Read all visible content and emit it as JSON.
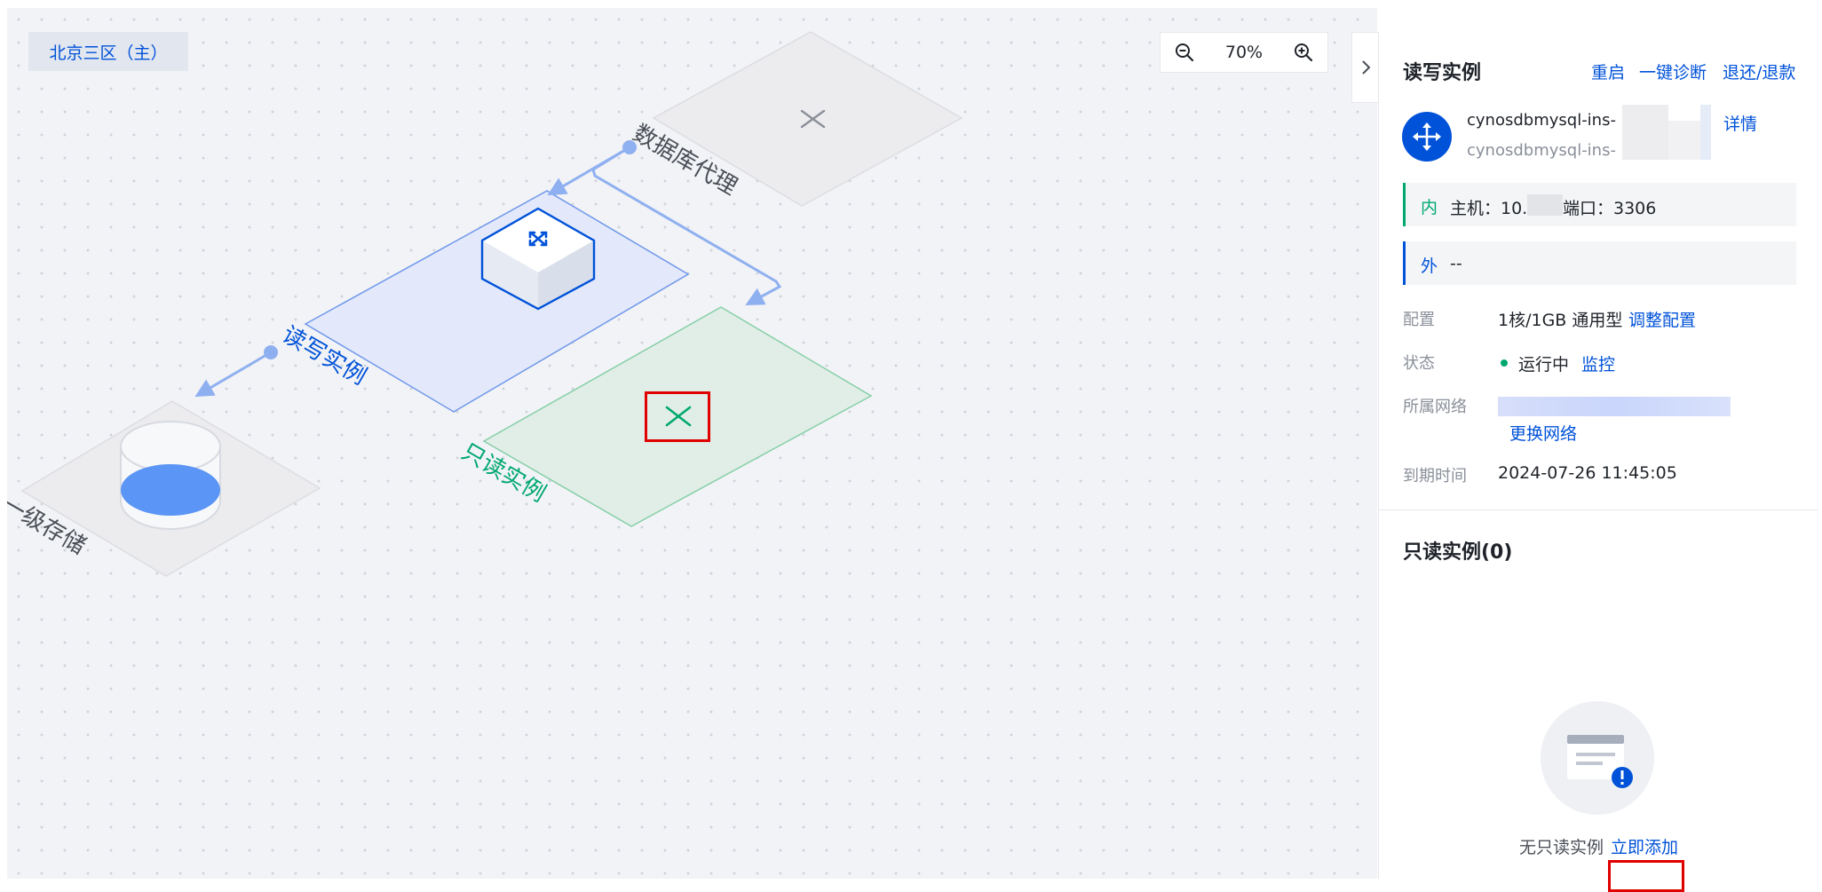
{
  "canvas": {
    "region_tag": "北京三区（主）",
    "zoom": "70%",
    "nodes": {
      "proxy_label": "数据库代理",
      "rw_label": "读写实例",
      "ro_label": "只读实例",
      "storage_label": "一级存储"
    }
  },
  "panel": {
    "title": "读写实例",
    "actions": {
      "restart": "重启",
      "diagnose": "一键诊断",
      "refund": "退还/退款"
    },
    "instance": {
      "id": "cynosdbmysql-ins-",
      "name": "cynosdbmysql-ins-",
      "details_link": "详情"
    },
    "network": {
      "internal_tag": "内",
      "internal_text": "主机：10.",
      "port_text": "端口：3306",
      "external_tag": "外",
      "external_text": "--"
    },
    "fields": {
      "config_label": "配置",
      "config_value": "1核/1GB 通用型",
      "config_link": "调整配置",
      "status_label": "状态",
      "status_value": "运行中",
      "status_link": "监控",
      "network_label": "所属网络",
      "network_link": "更换网络",
      "expire_label": "到期时间",
      "expire_value": "2024-07-26 11:45:05"
    },
    "readonly": {
      "title": "只读实例(0)",
      "empty_text": "无只读实例",
      "add_link": "立即添加"
    }
  },
  "colors": {
    "accent": "#0052d9",
    "success": "#00a870",
    "highlight": "#e00000"
  }
}
